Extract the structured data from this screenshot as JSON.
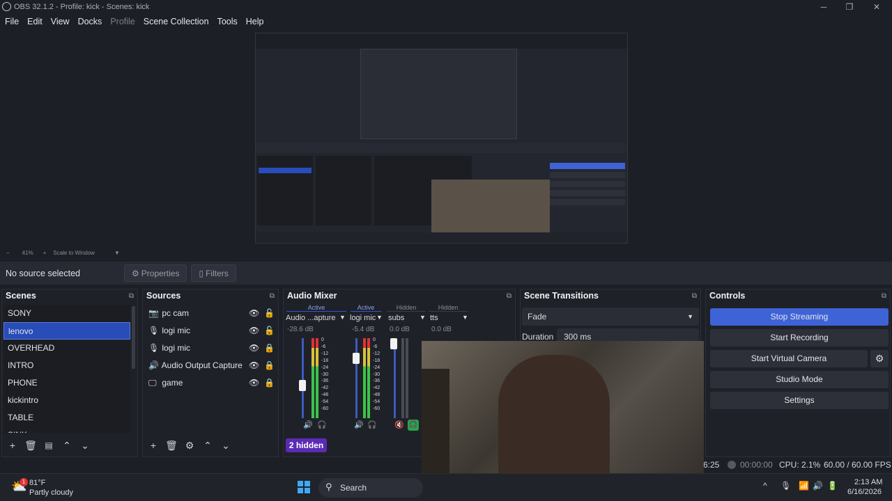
{
  "window": {
    "title": "OBS 32.1.2 - Profile: kick - Scenes: kick"
  },
  "menu": [
    "File",
    "Edit",
    "View",
    "Docks",
    "Profile",
    "Scene Collection",
    "Tools",
    "Help"
  ],
  "preview": {
    "zoom": "41%",
    "scale_mode": "Scale to Window"
  },
  "source_bar": {
    "status": "No source selected",
    "properties": "Properties",
    "filters": "Filters"
  },
  "scenes": {
    "title": "Scenes",
    "items": [
      "SONY",
      "lenovo",
      "OVERHEAD",
      "INTRO",
      "PHONE",
      "kickintro",
      "TABLE",
      "SINK"
    ],
    "selected": "lenovo"
  },
  "sources": {
    "title": "Sources",
    "items": [
      {
        "name": "pc cam",
        "icon": "camera-icon",
        "locked": false
      },
      {
        "name": "logi mic",
        "icon": "microphone-icon",
        "locked": false
      },
      {
        "name": "logi mic",
        "icon": "microphone-icon",
        "locked": true
      },
      {
        "name": "Audio Output Capture",
        "icon": "speaker-icon",
        "locked": true
      },
      {
        "name": "game",
        "icon": "monitor-icon",
        "locked": true
      }
    ]
  },
  "mixer": {
    "title": "Audio Mixer",
    "channels": [
      {
        "state": "Active",
        "name": "Audio ...apture",
        "db": "-28.6 dB",
        "level": 0.85
      },
      {
        "state": "Active",
        "name": "logi mic",
        "db": "-5.4 dB",
        "level": 0.9
      },
      {
        "state": "Hidden",
        "name": "subs",
        "db": "0.0 dB",
        "level": 0.0
      },
      {
        "state": "Hidden",
        "name": "tts",
        "db": "0.0 dB",
        "level": 0.0
      }
    ],
    "ticks": [
      "0",
      "-6",
      "-12",
      "-18",
      "-24",
      "-30",
      "-36",
      "-42",
      "-48",
      "-54",
      "-60"
    ],
    "hidden_label": "2 hidden"
  },
  "transitions": {
    "title": "Scene Transitions",
    "type": "Fade",
    "duration_label": "Duration",
    "duration": "300 ms"
  },
  "controls": {
    "title": "Controls",
    "stop_streaming": "Stop Streaming",
    "start_recording": "Start Recording",
    "start_virtual_camera": "Start Virtual Camera",
    "studio_mode": "Studio Mode",
    "settings": "Settings"
  },
  "status": {
    "stream_time": "6:25",
    "rec_time": "00:00:00",
    "cpu": "CPU: 2.1%",
    "fps": "60.00 / 60.00 FPS"
  },
  "taskbar": {
    "weather_temp": "81°F",
    "weather_desc": "Partly cloudy",
    "badge": "1",
    "search": "Search",
    "time": "2:13 AM",
    "date": "6/16/2026"
  },
  "colors": {
    "accent": "#284cb8",
    "stream_button": "#3e63d6",
    "mixer_active": "#8aa0e8",
    "hidden_badge": "#5b2bb5"
  }
}
